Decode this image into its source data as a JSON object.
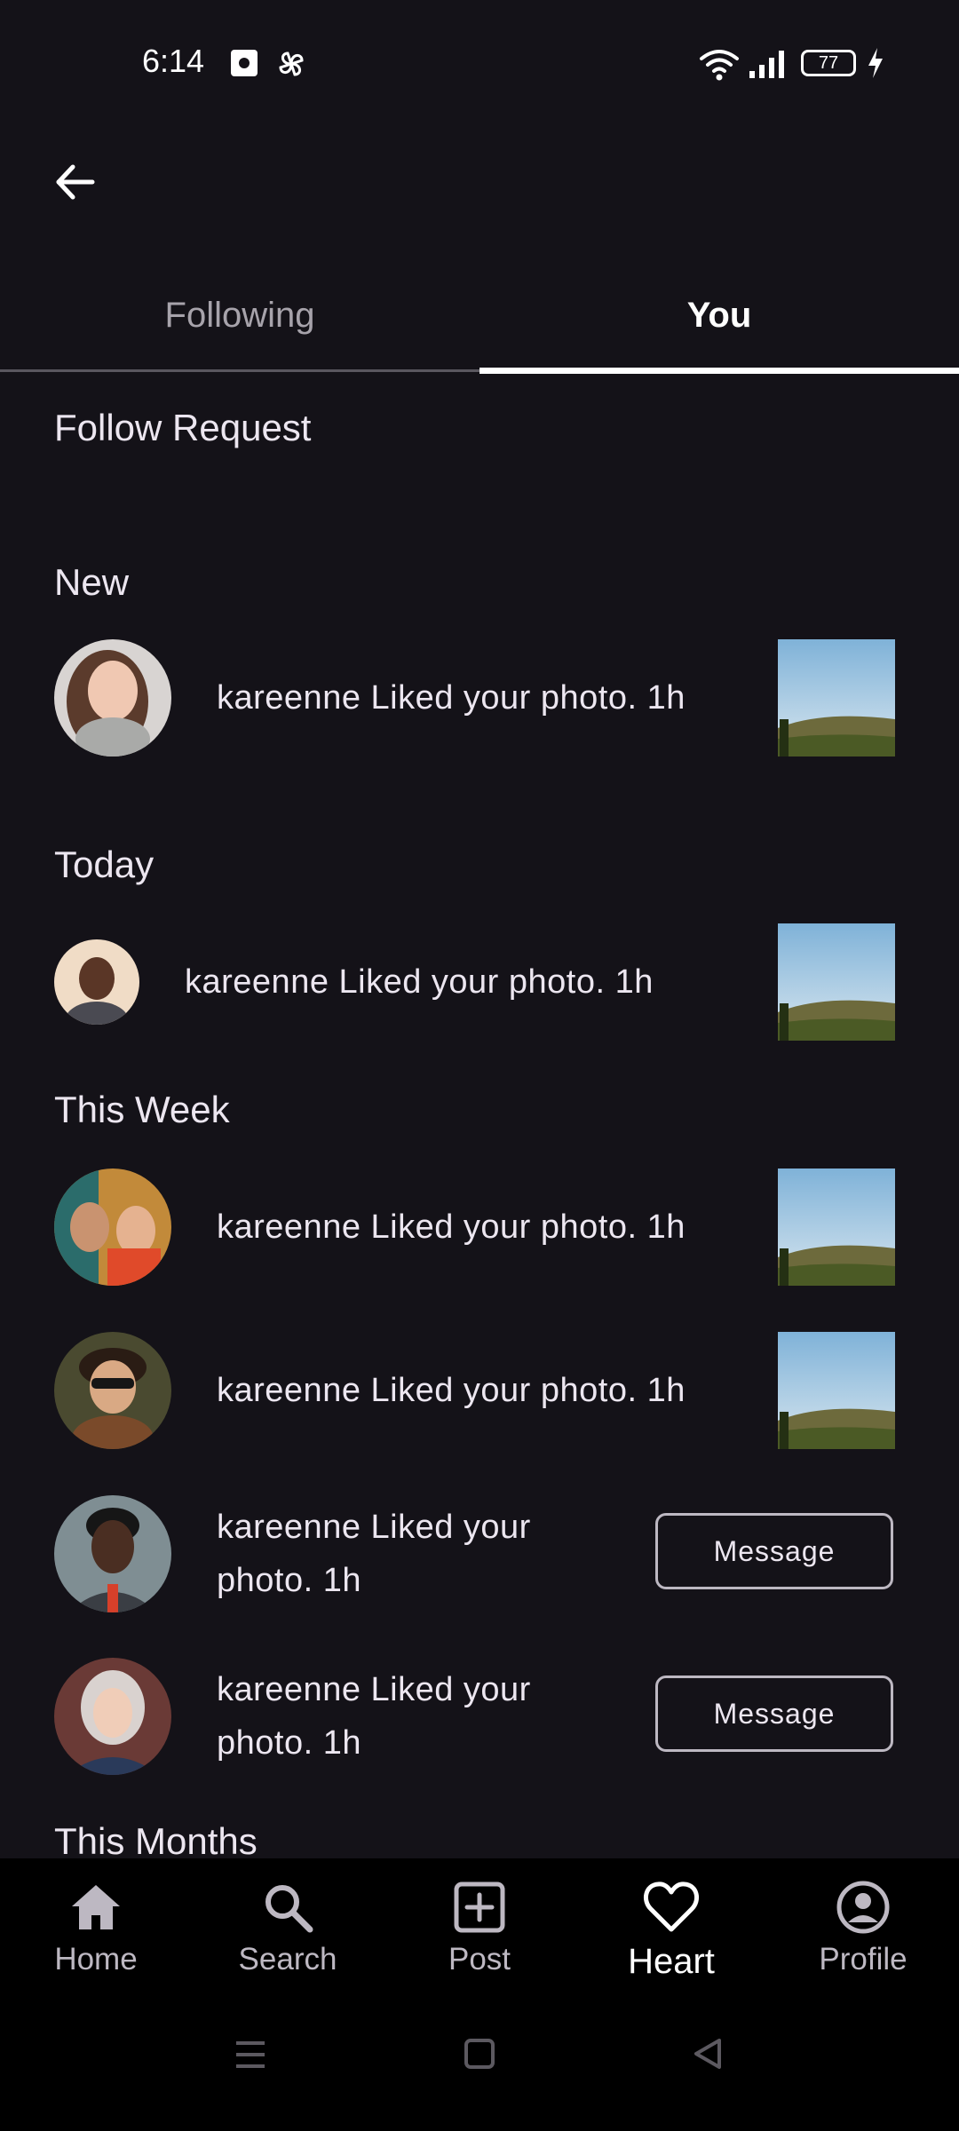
{
  "status_bar": {
    "time": "6:14",
    "battery": "77"
  },
  "tabs": [
    {
      "label": "Following"
    },
    {
      "label": "You"
    }
  ],
  "sections": {
    "follow_request": "Follow Request",
    "new": "New",
    "today": "Today",
    "this_week": "This Week",
    "this_months": "This Months"
  },
  "notifications": {
    "new": [
      {
        "text": "kareenne Liked your photo.  1h"
      }
    ],
    "today": [
      {
        "text": "kareenne Liked your photo.  1h"
      }
    ],
    "this_week": [
      {
        "text": "kareenne Liked your photo.  1h"
      },
      {
        "text": "kareenne Liked your photo.  1h"
      },
      {
        "text_line1": "kareenne Liked your",
        "text_line2": "photo.  1h",
        "button": "Message"
      },
      {
        "text_line1": "kareenne Liked your",
        "text_line2": "photo.  1h",
        "button": "Message"
      }
    ]
  },
  "bottom_nav": [
    {
      "label": "Home",
      "icon": "home-icon"
    },
    {
      "label": "Search",
      "icon": "search-icon"
    },
    {
      "label": "Post",
      "icon": "add-box-icon"
    },
    {
      "label": "Heart",
      "icon": "heart-icon",
      "active": true
    },
    {
      "label": "Profile",
      "icon": "profile-icon"
    }
  ]
}
